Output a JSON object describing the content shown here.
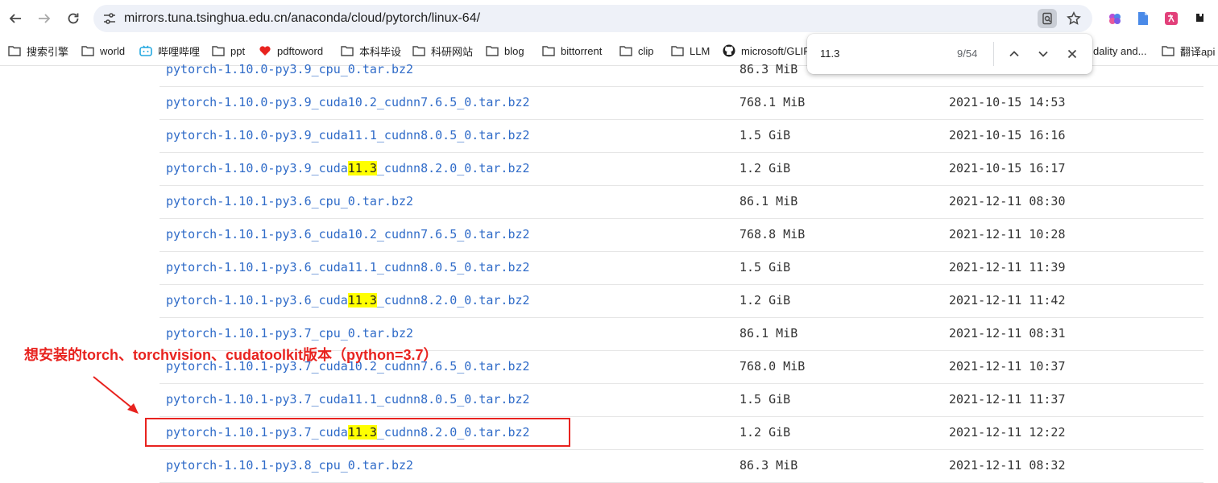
{
  "browser": {
    "url": "mirrors.tuna.tsinghua.edu.cn/anaconda/cloud/pytorch/linux-64/"
  },
  "bookmarks": [
    {
      "label": "搜索引擎",
      "icon": "folder-icon"
    },
    {
      "label": "world",
      "icon": "folder-icon"
    },
    {
      "label": "哔哩哔哩",
      "icon": "bilibili-icon"
    },
    {
      "label": "ppt",
      "icon": "folder-icon"
    },
    {
      "label": "pdftoword",
      "icon": "heart-icon"
    },
    {
      "label": "本科毕设",
      "icon": "folder-icon"
    },
    {
      "label": "科研网站",
      "icon": "folder-icon"
    },
    {
      "label": "blog",
      "icon": "folder-icon"
    },
    {
      "label": "bittorrent",
      "icon": "folder-icon"
    },
    {
      "label": "clip",
      "icon": "folder-icon"
    },
    {
      "label": "LLM",
      "icon": "folder-icon"
    },
    {
      "label": "microsoft/GLIP",
      "icon": "github-icon"
    },
    {
      "label": "dality and...",
      "icon": "none"
    },
    {
      "label": "翻译api",
      "icon": "folder-icon"
    }
  ],
  "find": {
    "query": "11.3",
    "count": "9/54"
  },
  "highlight_term": "11.3",
  "files": [
    {
      "name": "pytorch-1.10.0-py3.9_cpu_0.tar.bz2",
      "size": "86.3 MiB",
      "date": ""
    },
    {
      "name": "pytorch-1.10.0-py3.9_cuda10.2_cudnn7.6.5_0.tar.bz2",
      "size": "768.1 MiB",
      "date": "2021-10-15 14:53"
    },
    {
      "name": "pytorch-1.10.0-py3.9_cuda11.1_cudnn8.0.5_0.tar.bz2",
      "size": "1.5 GiB",
      "date": "2021-10-15 16:16"
    },
    {
      "name": "pytorch-1.10.0-py3.9_cuda11.3_cudnn8.2.0_0.tar.bz2",
      "size": "1.2 GiB",
      "date": "2021-10-15 16:17"
    },
    {
      "name": "pytorch-1.10.1-py3.6_cpu_0.tar.bz2",
      "size": "86.1 MiB",
      "date": "2021-12-11 08:30"
    },
    {
      "name": "pytorch-1.10.1-py3.6_cuda10.2_cudnn7.6.5_0.tar.bz2",
      "size": "768.8 MiB",
      "date": "2021-12-11 10:28"
    },
    {
      "name": "pytorch-1.10.1-py3.6_cuda11.1_cudnn8.0.5_0.tar.bz2",
      "size": "1.5 GiB",
      "date": "2021-12-11 11:39"
    },
    {
      "name": "pytorch-1.10.1-py3.6_cuda11.3_cudnn8.2.0_0.tar.bz2",
      "size": "1.2 GiB",
      "date": "2021-12-11 11:42"
    },
    {
      "name": "pytorch-1.10.1-py3.7_cpu_0.tar.bz2",
      "size": "86.1 MiB",
      "date": "2021-12-11 08:31"
    },
    {
      "name": "pytorch-1.10.1-py3.7_cuda10.2_cudnn7.6.5_0.tar.bz2",
      "size": "768.0 MiB",
      "date": "2021-12-11 10:37"
    },
    {
      "name": "pytorch-1.10.1-py3.7_cuda11.1_cudnn8.0.5_0.tar.bz2",
      "size": "1.5 GiB",
      "date": "2021-12-11 11:37"
    },
    {
      "name": "pytorch-1.10.1-py3.7_cuda11.3_cudnn8.2.0_0.tar.bz2",
      "size": "1.2 GiB",
      "date": "2021-12-11 12:22"
    },
    {
      "name": "pytorch-1.10.1-py3.8_cpu_0.tar.bz2",
      "size": "86.3 MiB",
      "date": "2021-12-11 08:32"
    }
  ],
  "annotation": {
    "text": "想安装的torch、torchvision、cudatoolkit版本（python=3.7）",
    "color": "#e8231f"
  },
  "colors": {
    "link": "#2f6bc8",
    "highlight": "#ffff00",
    "omnibox": "#eef1f8"
  }
}
